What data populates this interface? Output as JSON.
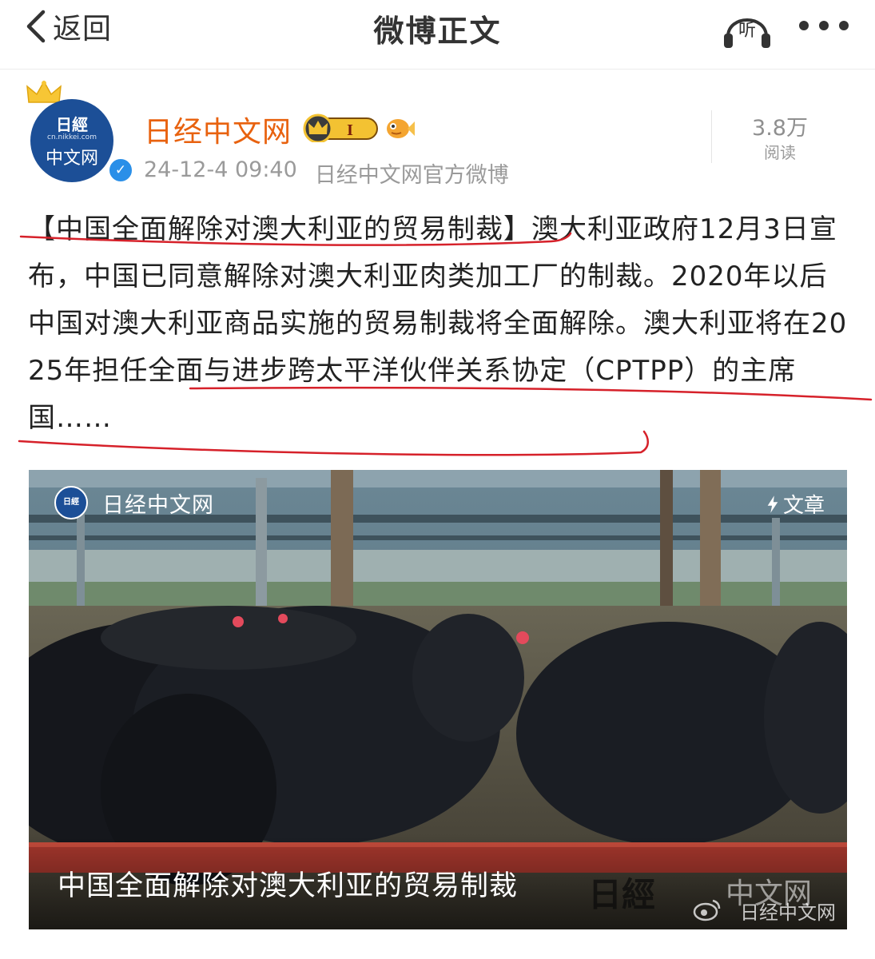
{
  "header": {
    "back_label": "返回",
    "title": "微博正文",
    "listen_label": "听"
  },
  "post": {
    "avatar": {
      "top_text": "日經",
      "url_text": "cn.nikkei.com",
      "bottom_text": "中文网",
      "verified_mark": "✓"
    },
    "author": "日经中文网",
    "vip_level": "I",
    "timestamp": "24-12-4 09:40",
    "source": "日经中文网官方微博",
    "read_count": "3.8万",
    "read_label": "阅读",
    "text_title": "【中国全面解除对澳大利亚的贸易制裁】",
    "text_body_1": "澳大利亚政府12月3日宣布，中国已同意解除对澳大利亚肉类加工厂的制裁。2020年以后中国对澳大利亚商品实施的贸易制裁将全面解除。",
    "text_body_2": "澳大利亚将在2025年担任全面与进步跨太平洋伙伴关系协定（CPTPP）的主席国……",
    "annotation_color": "#d6212a"
  },
  "article_card": {
    "source_name": "日经中文网",
    "source_logo_text": "日經",
    "tag_label": "文章",
    "caption": "中国全面解除对澳大利亚的贸易制裁",
    "watermark_logo": "日經",
    "watermark_cn": "中文网",
    "watermark_small": "日经中文网"
  }
}
